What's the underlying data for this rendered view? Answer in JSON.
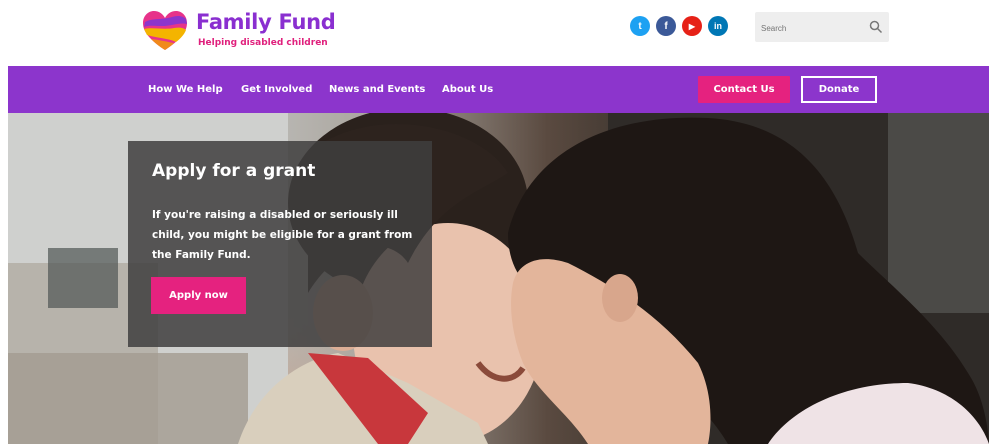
{
  "brand": {
    "name": "Family Fund",
    "tagline": "Helping disabled children",
    "logo_icon": "heart-logo-icon"
  },
  "social": [
    {
      "name": "twitter-icon",
      "glyph": "t",
      "color": "#1da1f2"
    },
    {
      "name": "facebook-icon",
      "glyph": "f",
      "color": "#3b5998"
    },
    {
      "name": "youtube-icon",
      "glyph": "▶",
      "color": "#e62117"
    },
    {
      "name": "linkedin-icon",
      "glyph": "in",
      "color": "#0077b5"
    }
  ],
  "search": {
    "placeholder": "Search",
    "icon": "search-icon"
  },
  "nav": {
    "items": [
      "How We Help",
      "Get Involved",
      "News and Events",
      "About Us"
    ],
    "contact_label": "Contact Us",
    "donate_label": "Donate"
  },
  "hero": {
    "title": "Apply for a grant",
    "body": "If you're raising a disabled or seriously ill child, you might be eligible for a grant from the Family Fund.",
    "cta_label": "Apply now"
  },
  "colors": {
    "purple": "#8c35cc",
    "pink": "#e5227f"
  }
}
